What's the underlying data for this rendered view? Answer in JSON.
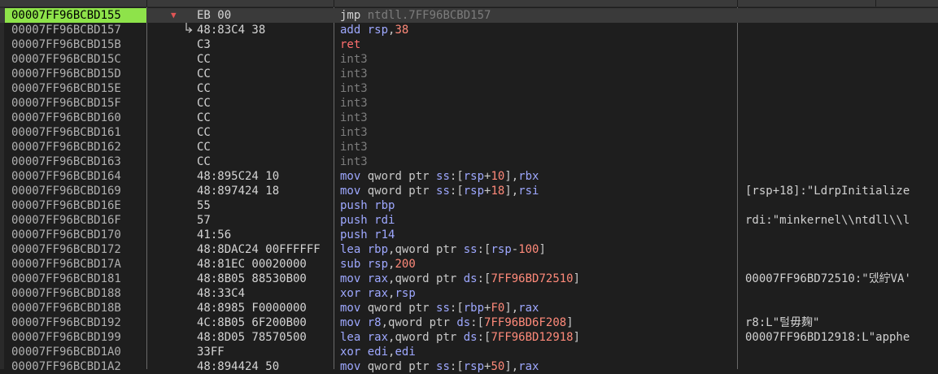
{
  "colors": {
    "background": "#1e1e1e",
    "selected_address_bg": "#8ee34a",
    "selected_row_bg": "#3a3a3a",
    "mnemonic": "#9ea8ff",
    "register": "#9ea8ff",
    "immediate": "#ff8a7a",
    "ret": "#ff6e6e",
    "int3": "#7c7c7c",
    "jump_marker": "#e05555"
  },
  "icons": {
    "jump_marker": "chevron-down-icon",
    "jump_arrow": "jump-arrow-icon"
  },
  "selected_index": 0,
  "rows": [
    {
      "addr": "00007FF96BCBD155",
      "marker": "▼",
      "bytes": "EB 00",
      "mnemonic": "jmp",
      "kind": "jmp",
      "ops": [
        {
          "t": "ntdll.7FF96BCBD157",
          "c": "dim"
        }
      ],
      "comment": ""
    },
    {
      "addr": "00007FF96BCBD157",
      "marker": "",
      "bytes": "48:83C4 38",
      "mnemonic": "add",
      "kind": "gen",
      "ops": [
        {
          "t": "rsp",
          "c": "reg"
        },
        {
          "t": ",",
          "c": "txt"
        },
        {
          "t": "38",
          "c": "num"
        }
      ],
      "comment": ""
    },
    {
      "addr": "00007FF96BCBD15B",
      "marker": "",
      "bytes": "C3",
      "mnemonic": "ret",
      "kind": "ret",
      "ops": [],
      "comment": ""
    },
    {
      "addr": "00007FF96BCBD15C",
      "marker": "",
      "bytes": "CC",
      "mnemonic": "int3",
      "kind": "int3",
      "ops": [],
      "comment": ""
    },
    {
      "addr": "00007FF96BCBD15D",
      "marker": "",
      "bytes": "CC",
      "mnemonic": "int3",
      "kind": "int3",
      "ops": [],
      "comment": ""
    },
    {
      "addr": "00007FF96BCBD15E",
      "marker": "",
      "bytes": "CC",
      "mnemonic": "int3",
      "kind": "int3",
      "ops": [],
      "comment": ""
    },
    {
      "addr": "00007FF96BCBD15F",
      "marker": "",
      "bytes": "CC",
      "mnemonic": "int3",
      "kind": "int3",
      "ops": [],
      "comment": ""
    },
    {
      "addr": "00007FF96BCBD160",
      "marker": "",
      "bytes": "CC",
      "mnemonic": "int3",
      "kind": "int3",
      "ops": [],
      "comment": ""
    },
    {
      "addr": "00007FF96BCBD161",
      "marker": "",
      "bytes": "CC",
      "mnemonic": "int3",
      "kind": "int3",
      "ops": [],
      "comment": ""
    },
    {
      "addr": "00007FF96BCBD162",
      "marker": "",
      "bytes": "CC",
      "mnemonic": "int3",
      "kind": "int3",
      "ops": [],
      "comment": ""
    },
    {
      "addr": "00007FF96BCBD163",
      "marker": "",
      "bytes": "CC",
      "mnemonic": "int3",
      "kind": "int3",
      "ops": [],
      "comment": ""
    },
    {
      "addr": "00007FF96BCBD164",
      "marker": "",
      "bytes": "48:895C24 10",
      "mnemonic": "mov",
      "kind": "gen",
      "ops": [
        {
          "t": "qword ptr ",
          "c": "txt"
        },
        {
          "t": "ss",
          "c": "reg"
        },
        {
          "t": ":[",
          "c": "txt"
        },
        {
          "t": "rsp",
          "c": "reg"
        },
        {
          "t": "+",
          "c": "txt"
        },
        {
          "t": "10",
          "c": "num"
        },
        {
          "t": "],",
          "c": "txt"
        },
        {
          "t": "rbx",
          "c": "reg"
        }
      ],
      "comment": ""
    },
    {
      "addr": "00007FF96BCBD169",
      "marker": "",
      "bytes": "48:897424 18",
      "mnemonic": "mov",
      "kind": "gen",
      "ops": [
        {
          "t": "qword ptr ",
          "c": "txt"
        },
        {
          "t": "ss",
          "c": "reg"
        },
        {
          "t": ":[",
          "c": "txt"
        },
        {
          "t": "rsp",
          "c": "reg"
        },
        {
          "t": "+",
          "c": "txt"
        },
        {
          "t": "18",
          "c": "num"
        },
        {
          "t": "],",
          "c": "txt"
        },
        {
          "t": "rsi",
          "c": "reg"
        }
      ],
      "comment": "[rsp+18]:\"LdrpInitialize"
    },
    {
      "addr": "00007FF96BCBD16E",
      "marker": "",
      "bytes": "55",
      "mnemonic": "push",
      "kind": "gen",
      "ops": [
        {
          "t": "rbp",
          "c": "reg"
        }
      ],
      "comment": ""
    },
    {
      "addr": "00007FF96BCBD16F",
      "marker": "",
      "bytes": "57",
      "mnemonic": "push",
      "kind": "gen",
      "ops": [
        {
          "t": "rdi",
          "c": "reg"
        }
      ],
      "comment": "rdi:\"minkernel\\\\ntdll\\\\l"
    },
    {
      "addr": "00007FF96BCBD170",
      "marker": "",
      "bytes": "41:56",
      "mnemonic": "push",
      "kind": "gen",
      "ops": [
        {
          "t": "r14",
          "c": "reg"
        }
      ],
      "comment": ""
    },
    {
      "addr": "00007FF96BCBD172",
      "marker": "",
      "bytes": "48:8DAC24 00FFFFFF",
      "mnemonic": "lea",
      "kind": "gen",
      "ops": [
        {
          "t": "rbp",
          "c": "reg"
        },
        {
          "t": ",qword ptr ",
          "c": "txt"
        },
        {
          "t": "ss",
          "c": "reg"
        },
        {
          "t": ":[",
          "c": "txt"
        },
        {
          "t": "rsp",
          "c": "reg"
        },
        {
          "t": "-",
          "c": "txt"
        },
        {
          "t": "100",
          "c": "num"
        },
        {
          "t": "]",
          "c": "txt"
        }
      ],
      "comment": ""
    },
    {
      "addr": "00007FF96BCBD17A",
      "marker": "",
      "bytes": "48:81EC 00020000",
      "mnemonic": "sub",
      "kind": "gen",
      "ops": [
        {
          "t": "rsp",
          "c": "reg"
        },
        {
          "t": ",",
          "c": "txt"
        },
        {
          "t": "200",
          "c": "num"
        }
      ],
      "comment": ""
    },
    {
      "addr": "00007FF96BCBD181",
      "marker": "",
      "bytes": "48:8B05 88530B00",
      "mnemonic": "mov",
      "kind": "gen",
      "ops": [
        {
          "t": "rax",
          "c": "reg"
        },
        {
          "t": ",qword ptr ",
          "c": "txt"
        },
        {
          "t": "ds",
          "c": "reg"
        },
        {
          "t": ":[",
          "c": "txt"
        },
        {
          "t": "7FF96BD72510",
          "c": "num"
        },
        {
          "t": "]",
          "c": "txt"
        }
      ],
      "comment": "00007FF96BD72510:\"뎄紵VA'"
    },
    {
      "addr": "00007FF96BCBD188",
      "marker": "",
      "bytes": "48:33C4",
      "mnemonic": "xor",
      "kind": "gen",
      "ops": [
        {
          "t": "rax",
          "c": "reg"
        },
        {
          "t": ",",
          "c": "txt"
        },
        {
          "t": "rsp",
          "c": "reg"
        }
      ],
      "comment": ""
    },
    {
      "addr": "00007FF96BCBD18B",
      "marker": "",
      "bytes": "48:8985 F0000000",
      "mnemonic": "mov",
      "kind": "gen",
      "ops": [
        {
          "t": "qword ptr ",
          "c": "txt"
        },
        {
          "t": "ss",
          "c": "reg"
        },
        {
          "t": ":[",
          "c": "txt"
        },
        {
          "t": "rbp",
          "c": "reg"
        },
        {
          "t": "+",
          "c": "txt"
        },
        {
          "t": "F0",
          "c": "num"
        },
        {
          "t": "],",
          "c": "txt"
        },
        {
          "t": "rax",
          "c": "reg"
        }
      ],
      "comment": ""
    },
    {
      "addr": "00007FF96BCBD192",
      "marker": "",
      "bytes": "4C:8B05 6F200B00",
      "mnemonic": "mov",
      "kind": "gen",
      "ops": [
        {
          "t": "r8",
          "c": "reg"
        },
        {
          "t": ",qword ptr ",
          "c": "txt"
        },
        {
          "t": "ds",
          "c": "reg"
        },
        {
          "t": ":[",
          "c": "txt"
        },
        {
          "t": "7FF96BD6F208",
          "c": "num"
        },
        {
          "t": "]",
          "c": "txt"
        }
      ],
      "comment": "r8:L\"털毋麹\""
    },
    {
      "addr": "00007FF96BCBD199",
      "marker": "",
      "bytes": "48:8D05 78570500",
      "mnemonic": "lea",
      "kind": "gen",
      "ops": [
        {
          "t": "rax",
          "c": "reg"
        },
        {
          "t": ",qword ptr ",
          "c": "txt"
        },
        {
          "t": "ds",
          "c": "reg"
        },
        {
          "t": ":[",
          "c": "txt"
        },
        {
          "t": "7FF96BD12918",
          "c": "num"
        },
        {
          "t": "]",
          "c": "txt"
        }
      ],
      "comment": "00007FF96BD12918:L\"apphe"
    },
    {
      "addr": "00007FF96BCBD1A0",
      "marker": "",
      "bytes": "33FF",
      "mnemonic": "xor",
      "kind": "gen",
      "ops": [
        {
          "t": "edi",
          "c": "reg"
        },
        {
          "t": ",",
          "c": "txt"
        },
        {
          "t": "edi",
          "c": "reg"
        }
      ],
      "comment": ""
    },
    {
      "addr": "00007FF96BCBD1A2",
      "marker": "",
      "bytes": "48:894424 50",
      "mnemonic": "mov",
      "kind": "gen",
      "ops": [
        {
          "t": "qword ptr ",
          "c": "txt"
        },
        {
          "t": "ss",
          "c": "reg"
        },
        {
          "t": ":[",
          "c": "txt"
        },
        {
          "t": "rsp",
          "c": "reg"
        },
        {
          "t": "+",
          "c": "txt"
        },
        {
          "t": "50",
          "c": "num"
        },
        {
          "t": "],",
          "c": "txt"
        },
        {
          "t": "rax",
          "c": "reg"
        }
      ],
      "comment": ""
    }
  ]
}
